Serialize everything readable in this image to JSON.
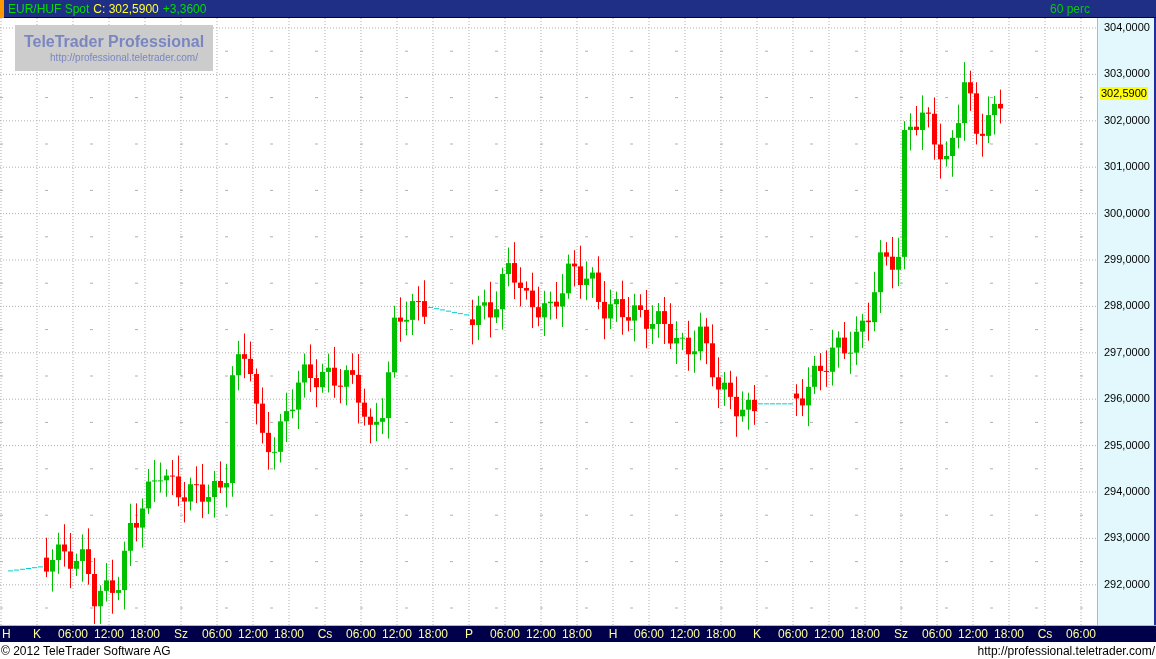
{
  "title_bar": {
    "symbol": "EUR/HUF Spot",
    "close": "C: 302,5900",
    "change": "+3,3600",
    "interval": "60 perc"
  },
  "logo": {
    "name": "TeleTrader Professional",
    "url": "http://professional.teletrader.com/"
  },
  "price_axis": {
    "ticks": [
      "304,0000",
      "303,0000",
      "302,0000",
      "301,0000",
      "300,0000",
      "299,0000",
      "298,0000",
      "297,0000",
      "296,0000",
      "295,0000",
      "294,0000",
      "293,0000",
      "292,0000"
    ],
    "current_price": "302,5900"
  },
  "time_axis": [
    "H",
    "K",
    "06:00",
    "12:00",
    "18:00",
    "Sz",
    "06:00",
    "12:00",
    "18:00",
    "Cs",
    "06:00",
    "12:00",
    "18:00",
    "P",
    "06:00",
    "12:00",
    "18:00",
    "H",
    "06:00",
    "12:00",
    "18:00",
    "K",
    "06:00",
    "12:00",
    "18:00",
    "Sz",
    "06:00",
    "12:00",
    "18:00",
    "Cs",
    "06:00"
  ],
  "footer": {
    "copyright": "© 2012 TeleTrader Software AG",
    "url": "http://professional.teletrader.com/"
  }
}
